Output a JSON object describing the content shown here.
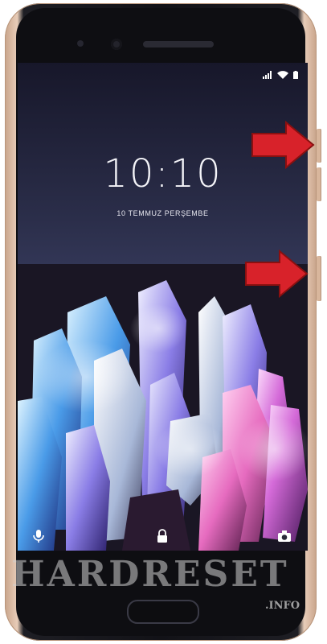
{
  "lockscreen": {
    "time": "10:10",
    "date": "10 TEMMUZ PERŞEMBE"
  },
  "status_icons": [
    "signal-icon",
    "wifi-icon",
    "battery-icon"
  ],
  "shortcuts": {
    "left": "microphone-icon",
    "center": "lock-icon",
    "right": "camera-icon"
  },
  "watermark": {
    "brand": "HARDRESET",
    "suffix": ".INFO"
  },
  "colors": {
    "arrow": "#d8222a",
    "phone_frame": "#e8cdb9",
    "screen_text": "#f4f4f8"
  }
}
